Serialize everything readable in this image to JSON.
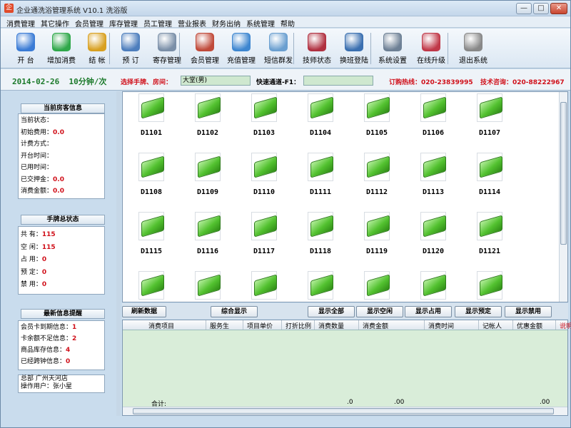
{
  "window": {
    "app_icon": "app-icon",
    "title": "企业通洗浴管理系统 V10.1  洗浴版",
    "controls": [
      "—",
      "□",
      "✕"
    ]
  },
  "menu": [
    "消费管理",
    "其它操作",
    "会员管理",
    "库存管理",
    "员工管理",
    "营业报表",
    "财务出纳",
    "系统管理",
    "帮助"
  ],
  "toolbar": [
    {
      "label": "开  台",
      "icon": "open-table-icon",
      "color": "#3a7bd5"
    },
    {
      "label": "增加消费",
      "icon": "add-consume-icon",
      "color": "#2fa84a"
    },
    {
      "label": "结  帐",
      "icon": "checkout-icon",
      "color": "#d8a020"
    },
    {
      "label": "预  订",
      "icon": "reserve-icon",
      "color": "#4d7ebd"
    },
    {
      "label": "寄存管理",
      "icon": "storage-icon",
      "color": "#7a8fa8"
    },
    {
      "label": "会员管理",
      "icon": "member-icon",
      "color": "#c04a3a"
    },
    {
      "label": "充值管理",
      "icon": "recharge-icon",
      "color": "#3d86d0"
    },
    {
      "label": "短信群发",
      "icon": "sms-icon",
      "color": "#6a9fd0"
    },
    {
      "label": "技师状态",
      "icon": "tech-status-icon",
      "color": "#b03040"
    },
    {
      "label": "换班登陆",
      "icon": "shift-login-icon",
      "color": "#3a6fb0"
    },
    {
      "label": "系统设置",
      "icon": "settings-icon",
      "color": "#6d8095"
    },
    {
      "label": "在线升级",
      "icon": "upgrade-icon",
      "color": "#c03848"
    },
    {
      "label": "退出系统",
      "icon": "exit-icon",
      "color": "#888888"
    }
  ],
  "infobar": {
    "date": "2014-02-26",
    "interval": "10分钟/次",
    "room_select_label": "选择手牌、房间：",
    "room_value": "大堂(男)",
    "quick_channel_label": "快速通道-F1：",
    "quick_channel_value": "",
    "order_hotline_label": "订购热线：",
    "order_hotline": "020-23839995",
    "tech_consult_label": "技术咨询：",
    "tech_consult": "020-88222967"
  },
  "current_room": {
    "title": "当前房客信息",
    "rows": [
      {
        "label": "当前状态：",
        "value": ""
      },
      {
        "label": "初始费用：",
        "value": "0.0"
      },
      {
        "label": "计费方式：",
        "value": ""
      },
      {
        "label": "开台时间：",
        "value": ""
      },
      {
        "label": "已用时间：",
        "value": ""
      },
      {
        "label": "已交押金：",
        "value": "0.0"
      },
      {
        "label": "消费金额：",
        "value": "0.0"
      }
    ]
  },
  "tag_status": {
    "title": "手牌总状态",
    "rows": [
      {
        "label": "共    有：",
        "value": "115"
      },
      {
        "label": "空    闲：",
        "value": "115"
      },
      {
        "label": "占    用：",
        "value": "0"
      },
      {
        "label": "预    定：",
        "value": "0"
      },
      {
        "label": "禁    用：",
        "value": "0"
      }
    ]
  },
  "alerts": {
    "title": "最新信息提醒",
    "rows": [
      {
        "label": "会员卡到期信息：",
        "value": "1"
      },
      {
        "label": "卡余额不足信息：",
        "value": "2"
      },
      {
        "label": "商品库存信息：",
        "value": "4"
      },
      {
        "label": "已经跨钟信息：",
        "value": "0"
      }
    ]
  },
  "store": {
    "line1": "总部  广州天河店",
    "line2": "操作用户：张小星"
  },
  "rooms": [
    "D1101",
    "D1102",
    "D1103",
    "D1104",
    "D1105",
    "D1106",
    "D1107",
    "D1108",
    "D1109",
    "D1110",
    "D1111",
    "D1112",
    "D1113",
    "D1114",
    "D1115",
    "D1116",
    "D1117",
    "D1118",
    "D1119",
    "D1120",
    "D1121",
    "",
    "",
    "",
    "",
    "",
    "",
    ""
  ],
  "actions": {
    "refresh": "刷新数据",
    "summary": "综合显示",
    "show_all": "显示全部",
    "show_free": "显示空闲",
    "show_occupied": "显示占用",
    "show_reserved": "显示预定",
    "show_disabled": "显示禁用"
  },
  "table": {
    "columns": [
      "消费项目",
      "服务生",
      "项目单价",
      "打折比例",
      "消费数量",
      "消费金额",
      "消费时间",
      "记帐人",
      "优惠金额",
      "说明"
    ],
    "total_label": "合计:",
    "total_qty": ".0",
    "total_amount": ".00",
    "total_discount": ".00"
  }
}
